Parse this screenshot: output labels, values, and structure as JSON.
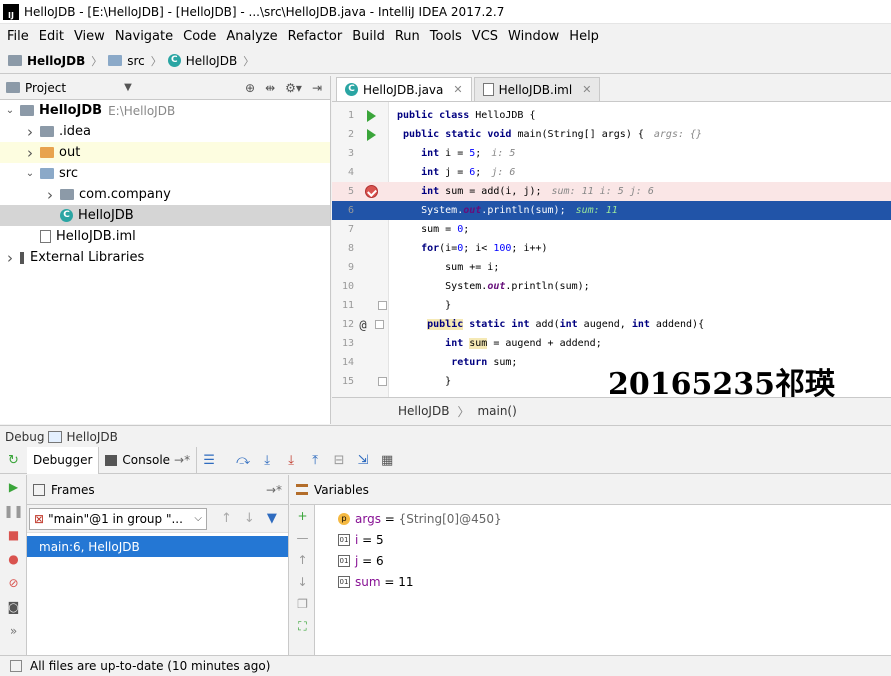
{
  "window": {
    "title": "HelloJDB - [E:\\HelloJDB] - [HelloJDB] - ...\\src\\HelloJDB.java - IntelliJ IDEA 2017.2.7",
    "logo": "IJ"
  },
  "menu": [
    "File",
    "Edit",
    "View",
    "Navigate",
    "Code",
    "Analyze",
    "Refactor",
    "Build",
    "Run",
    "Tools",
    "VCS",
    "Window",
    "Help"
  ],
  "nav": {
    "project": "HelloJDB",
    "folder": "src",
    "class": "HelloJDB"
  },
  "project_panel": {
    "title": "Project",
    "tree": [
      {
        "label": "HelloJDB",
        "hint": "E:\\HelloJDB",
        "level": 0,
        "arrow": "▼",
        "icon": "module-folder-icon"
      },
      {
        "label": ".idea",
        "level": 1,
        "arrow": "▶",
        "icon": "folder-icon"
      },
      {
        "label": "out",
        "level": 1,
        "arrow": "▶",
        "icon": "orange-folder-icon"
      },
      {
        "label": "src",
        "level": 1,
        "arrow": "▼",
        "icon": "source-folder-icon"
      },
      {
        "label": "com.company",
        "level": 2,
        "arrow": "▶",
        "icon": "package-icon"
      },
      {
        "label": "HelloJDB",
        "level": 2,
        "arrow": "",
        "icon": "class-icon"
      },
      {
        "label": "HelloJDB.iml",
        "level": 1,
        "arrow": "",
        "icon": "iml-file-icon"
      },
      {
        "label": "External Libraries",
        "level": 0,
        "arrow": "▶",
        "icon": "library-icon"
      }
    ]
  },
  "editor": {
    "tabs": [
      {
        "label": "HelloJDB.java",
        "active": true
      },
      {
        "label": "HelloJDB.iml",
        "active": false
      }
    ],
    "lines": [
      {
        "n": "1",
        "code": "public class HelloJDB {",
        "hint": ""
      },
      {
        "n": "2",
        "code": " public static void main(String[] args) {",
        "hint": "args: {}"
      },
      {
        "n": "3",
        "code": "    int i = 5;",
        "hint": "i: 5"
      },
      {
        "n": "4",
        "code": "    int j = 6;",
        "hint": "j: 6"
      },
      {
        "n": "5",
        "code": "    int sum = add(i, j);",
        "hint": "sum: 11  i: 5  j: 6"
      },
      {
        "n": "6",
        "code": "    System.out.println(sum);",
        "hint": "sum: 11"
      },
      {
        "n": "7",
        "code": "    sum = 0;",
        "hint": ""
      },
      {
        "n": "8",
        "code": "    for(i=0; i< 100; i++)",
        "hint": ""
      },
      {
        "n": "9",
        "code": "        sum += i;",
        "hint": ""
      },
      {
        "n": "10",
        "code": "        System.out.println(sum);",
        "hint": ""
      },
      {
        "n": "11",
        "code": "        }",
        "hint": ""
      },
      {
        "n": "12",
        "code": "     public static int add(int augend, int addend){",
        "hint": ""
      },
      {
        "n": "13",
        "code": "        int sum = augend + addend;",
        "hint": ""
      },
      {
        "n": "14",
        "code": "         return sum;",
        "hint": ""
      },
      {
        "n": "15",
        "code": "        }",
        "hint": ""
      }
    ],
    "watermark": "20165235祁瑛",
    "crumb": [
      "HelloJDB",
      "main()"
    ]
  },
  "debug": {
    "title": "Debug",
    "config": "HelloJDB",
    "tabs": {
      "debugger": "Debugger",
      "console": "Console"
    },
    "frames_title": "Frames",
    "thread": "\"main\"@1 in group \"...",
    "frame": "main:6, HelloJDB",
    "variables_title": "Variables",
    "variables": [
      {
        "name": "args",
        "eq": " = ",
        "value": "{String[0]@450}",
        "kind": "p"
      },
      {
        "name": "i",
        "eq": " = ",
        "value": "5",
        "kind": "prim"
      },
      {
        "name": "j",
        "eq": " = ",
        "value": "6",
        "kind": "prim"
      },
      {
        "name": "sum",
        "eq": " = ",
        "value": "11",
        "kind": "prim"
      }
    ]
  },
  "status": {
    "text": "All files are up-to-date (10 minutes ago)"
  }
}
